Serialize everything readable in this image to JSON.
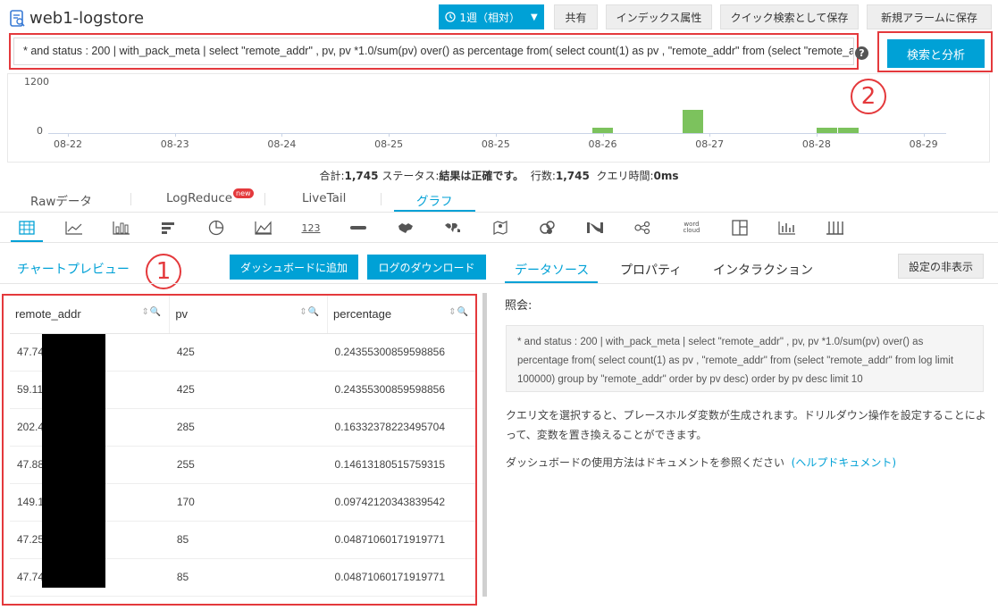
{
  "header": {
    "title": "web1-logstore",
    "time_range": "1週（相対）",
    "buttons": [
      "共有",
      "インデックス属性",
      "クイック検索として保存",
      "新規アラームに保存"
    ]
  },
  "query": {
    "value": "* and status : 200 | with_pack_meta | select \"remote_addr\" , pv, pv *1.0/sum(pv) over() as percentage from( select count(1) as pv , \"remote_addr\" from (select \"remote_addr\" from log limit 100000) group by \"remote_addr\" order by pv desc) order by pv desc limit 10",
    "help": "?",
    "search_button": "検索と分析"
  },
  "histogram": {
    "y_ticks": [
      "1200",
      "0"
    ],
    "x_ticks": [
      "08-22",
      "08-23",
      "08-24",
      "08-25",
      "08-25",
      "08-26",
      "08-27",
      "08-28",
      "08-29"
    ],
    "bar_color": "#7cc25d",
    "bars": [
      {
        "slot": 5.0,
        "value": 120
      },
      {
        "slot": 5.85,
        "value": 540
      },
      {
        "slot": 7.1,
        "value": 120
      },
      {
        "slot": 7.3,
        "value": 120
      }
    ],
    "y_max": 1200
  },
  "summary": {
    "total_label": "合計:",
    "total": "1,745",
    "status_label": "ステータス:",
    "status": "結果は正確です。",
    "rows_label": "行数:",
    "rows": "1,745",
    "time_label": "クエリ時間:",
    "time": "0ms"
  },
  "tabs": [
    "Rawデータ",
    "LogReduce",
    "LiveTail",
    "グラフ"
  ],
  "tab_new_badge": "new",
  "active_tab": "グラフ",
  "chart_icons": [
    "table-icon",
    "line-chart-icon",
    "column-chart-icon",
    "bar-chart-icon",
    "pie-chart-icon",
    "area-chart-icon",
    "single-value-icon",
    "progress-bar-icon",
    "map-icon",
    "world-map-icon",
    "amap-icon",
    "flow-chart-icon",
    "sankey-icon",
    "graph-icon",
    "word-cloud-icon",
    "treemap-icon",
    "trend-icon",
    "grid-icon"
  ],
  "chart_icon_123": "123",
  "chart_icon_wordcloud": "word cloud",
  "left_panel": {
    "title": "チャートプレビュー",
    "add_dashboard": "ダッシュボードに追加",
    "download_log": "ログのダウンロード",
    "marker1": "1",
    "columns": [
      "remote_addr",
      "pv",
      "percentage"
    ],
    "rows": [
      [
        "47.74",
        "425",
        "0.24355300859598856"
      ],
      [
        "59.11",
        "425",
        "0.24355300859598856"
      ],
      [
        "202.4",
        "285",
        "0.16332378223495704"
      ],
      [
        "47.88",
        "255",
        "0.14613180515759315"
      ],
      [
        "149.1",
        "170",
        "0.09742120343839542"
      ],
      [
        "47.25",
        "85",
        "0.04871060171919771"
      ],
      [
        "47.74",
        "85",
        "0.04871060171919771"
      ]
    ]
  },
  "marker2": "2",
  "right_panel": {
    "tabs": [
      "データソース",
      "プロパティ",
      "インタラクション"
    ],
    "hide_settings": "設定の非表示",
    "query_label": "照会:",
    "query_text": "* and status : 200 | with_pack_meta | select \"remote_addr\" , pv, pv *1.0/sum(pv) over() as percentage from( select count(1) as pv , \"remote_addr\" from (select \"remote_addr\" from log limit 100000) group by \"remote_addr\" order by pv desc) order by pv desc limit 10",
    "desc1": "クエリ文を選択すると、プレースホルダ変数が生成されます。ドリルダウン操作を設定することによって、変数を置き換えることができます。",
    "desc2": "ダッシュボードの使用方法はドキュメントを参照ください",
    "help_link": "(ヘルプドキュメント)"
  }
}
